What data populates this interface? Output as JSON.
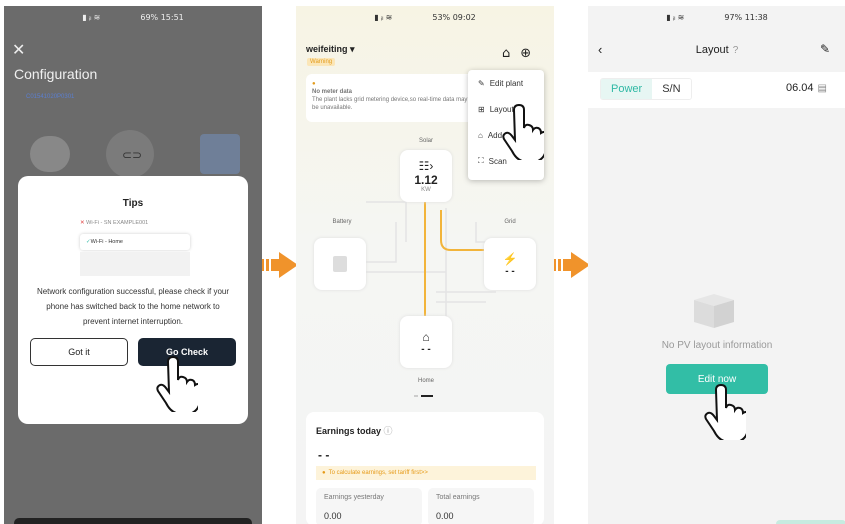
{
  "panel1": {
    "status_time": "15:51",
    "status_battery": "69%",
    "title": "Configuration",
    "device_sn": "C01541020P0301",
    "modal": {
      "title": "Tips",
      "wifi_fail": "Wi-Fi - SN EXAMPLE001",
      "wifi_home": "Wi-Fi - Home",
      "message": "Network configuration successful, please check if your phone has switched back to the home network to prevent internet interruption.",
      "btn_got": "Got it",
      "btn_go": "Go Check"
    }
  },
  "panel2": {
    "status_time": "09:02",
    "status_battery": "53%",
    "user": "weifeiting",
    "badge": "Warning",
    "notice_title": "No meter data",
    "notice_body": "The plant lacks grid metering device,so real-time data may be unavailable.",
    "menu": [
      "Edit plant",
      "Layout",
      "Add",
      "Scan"
    ],
    "solar_label": "Solar",
    "solar_value": "1.12",
    "solar_unit": "KW",
    "battery_label": "Battery",
    "grid_label": "Grid",
    "grid_value": "- -",
    "home_label": "Home",
    "home_value": "- -",
    "earnings_title": "Earnings today",
    "earnings_value": "- -",
    "tariff_tip": "To calculate earnings, set tariff first>>",
    "yesterday_label": "Earnings yesterday",
    "yesterday_value": "0.00",
    "total_label": "Total earnings",
    "total_value": "0.00"
  },
  "panel3": {
    "status_time": "11:38",
    "status_battery": "97%",
    "title": "Layout",
    "tab_power": "Power",
    "tab_sn": "S/N",
    "date": "06.04",
    "empty_text": "No PV layout information",
    "edit_now": "Edit now"
  },
  "colors": {
    "accent": "#32bea6",
    "dark_button": "#1a2533",
    "arrow": "#f0932b",
    "warning": "#e39c1d"
  }
}
